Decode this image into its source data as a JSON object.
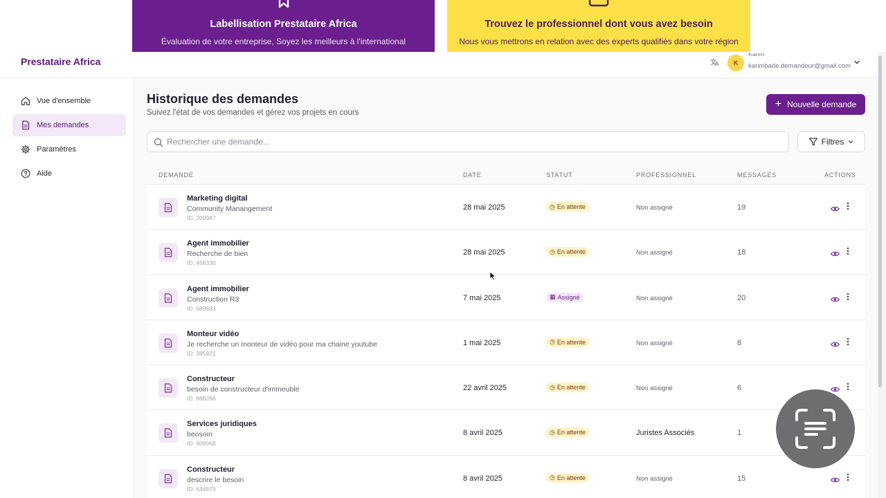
{
  "banners": {
    "left": {
      "title": "Labellisation Prestataire Africa",
      "subtitle": "Évaluation de votre entreprise, Soyez les meilleurs à l'international",
      "color": "#6b1e8e"
    },
    "right": {
      "title": "Trouvez le professionnel dont vous avez besoin",
      "subtitle": "Nous vous mettrons en relation avec des experts qualifiés dans votre région",
      "color": "#fde047"
    }
  },
  "header": {
    "brand": "Prestataire Africa",
    "user": {
      "avatar_initial": "K",
      "name": "Karim",
      "email": "karimbade.demandeur@gmail.com"
    }
  },
  "sidebar": {
    "items": [
      {
        "label": "Vue d'ensemble",
        "icon": "home-icon"
      },
      {
        "label": "Mes demandes",
        "icon": "document-icon",
        "active": true
      },
      {
        "label": "Paramètres",
        "icon": "gear-icon"
      },
      {
        "label": "Aide",
        "icon": "help-icon"
      }
    ]
  },
  "main": {
    "title": "Historique des demandes",
    "subtitle": "Suivez l'état de vos demandes et gérez vos projets en cours",
    "new_button": "Nouvelle demande",
    "search_placeholder": "Rechercher une demande...",
    "filter_label": "Filtres",
    "columns": [
      "Demande",
      "Date",
      "Statut",
      "Professionnel",
      "Messages",
      "Actions"
    ],
    "rows": [
      {
        "title": "Marketing digital",
        "desc": "Community Manangement",
        "id": "ID: 200987",
        "date": "28 mai 2025",
        "status": "En attente",
        "status_type": "pending",
        "pro": "Non assigné",
        "messages": "19"
      },
      {
        "title": "Agent immobilier",
        "desc": "Recherche de bien",
        "id": "ID: 458330",
        "date": "28 mai 2025",
        "status": "En attente",
        "status_type": "pending",
        "pro": "Non assigné",
        "messages": "18"
      },
      {
        "title": "Agent immobilier",
        "desc": "Construction R3",
        "id": "ID: 680683",
        "date": "7 mai 2025",
        "status": "Assigné",
        "status_type": "assigned",
        "pro": "Non assigné",
        "messages": "20"
      },
      {
        "title": "Monteur vidéo",
        "desc": "Je recherche un monteur de vidéo pour ma chaine youtube",
        "id": "ID: 385921",
        "date": "1 mai 2025",
        "status": "En attente",
        "status_type": "pending",
        "pro": "Non assigné",
        "messages": "8"
      },
      {
        "title": "Constructeur",
        "desc": "besoin de constructeur d'immeuble",
        "id": "ID: 888266",
        "date": "22 avril 2025",
        "status": "En attente",
        "status_type": "pending",
        "pro": "Non assigné",
        "messages": "6"
      },
      {
        "title": "Services juridiques",
        "desc": "beosoin",
        "id": "ID: 408068",
        "date": "8 avril 2025",
        "status": "En attente",
        "status_type": "pending",
        "pro": "Juristes Associés",
        "messages": "1"
      },
      {
        "title": "Constructeur",
        "desc": "descrire le besoin",
        "id": "ID: 644879",
        "date": "8 avril 2025",
        "status": "En attente",
        "status_type": "pending",
        "pro": "Non assigné",
        "messages": "15"
      }
    ]
  },
  "colors": {
    "accent": "#6b1e8e",
    "pending_bg": "#fef3c7",
    "assigned_bg": "#f3e8f7"
  }
}
